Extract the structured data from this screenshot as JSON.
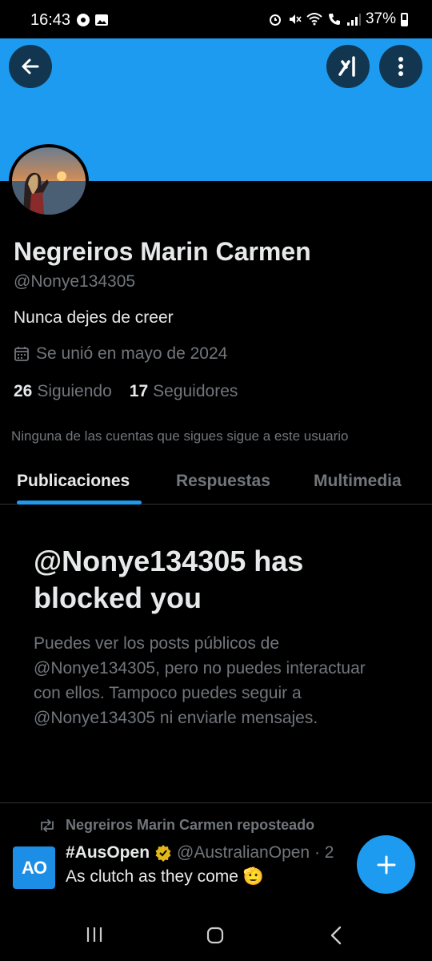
{
  "status_bar": {
    "time": "16:43",
    "battery": "37%"
  },
  "header": {
    "back_icon": "arrow-left-icon",
    "grok_icon": "grok-icon",
    "more_icon": "more-vertical-icon"
  },
  "profile": {
    "name": "Negreiros Marin Carmen",
    "handle": "@Nonye134305",
    "bio": "Nunca dejes de creer",
    "joined": "Se unió en mayo de 2024",
    "following_count": "26",
    "following_label": "Siguiendo",
    "followers_count": "17",
    "followers_label": "Seguidores",
    "mutuals_note": "Ninguna de las cuentas que sigues sigue a este usuario"
  },
  "tabs": [
    {
      "label": "Publicaciones",
      "active": true
    },
    {
      "label": "Respuestas",
      "active": false
    },
    {
      "label": "Multimedia",
      "active": false
    }
  ],
  "blocked": {
    "title": "@Nonye134305 has blocked you",
    "description": "Puedes ver los posts públicos de @Nonye134305, pero no puedes interactuar con ellos. Tampoco puedes seguir a @Nonye134305 ni enviarle mensajes."
  },
  "post": {
    "repost_label": "Negreiros Marin Carmen reposteado",
    "author_name": "#AusOpen",
    "author_handle": "@AustralianOpen · 2",
    "avatar_text": "AO",
    "text": "As clutch as they come 🫡"
  },
  "colors": {
    "accent": "#1d9bf0",
    "background": "#000000",
    "secondary_text": "#71767b"
  }
}
